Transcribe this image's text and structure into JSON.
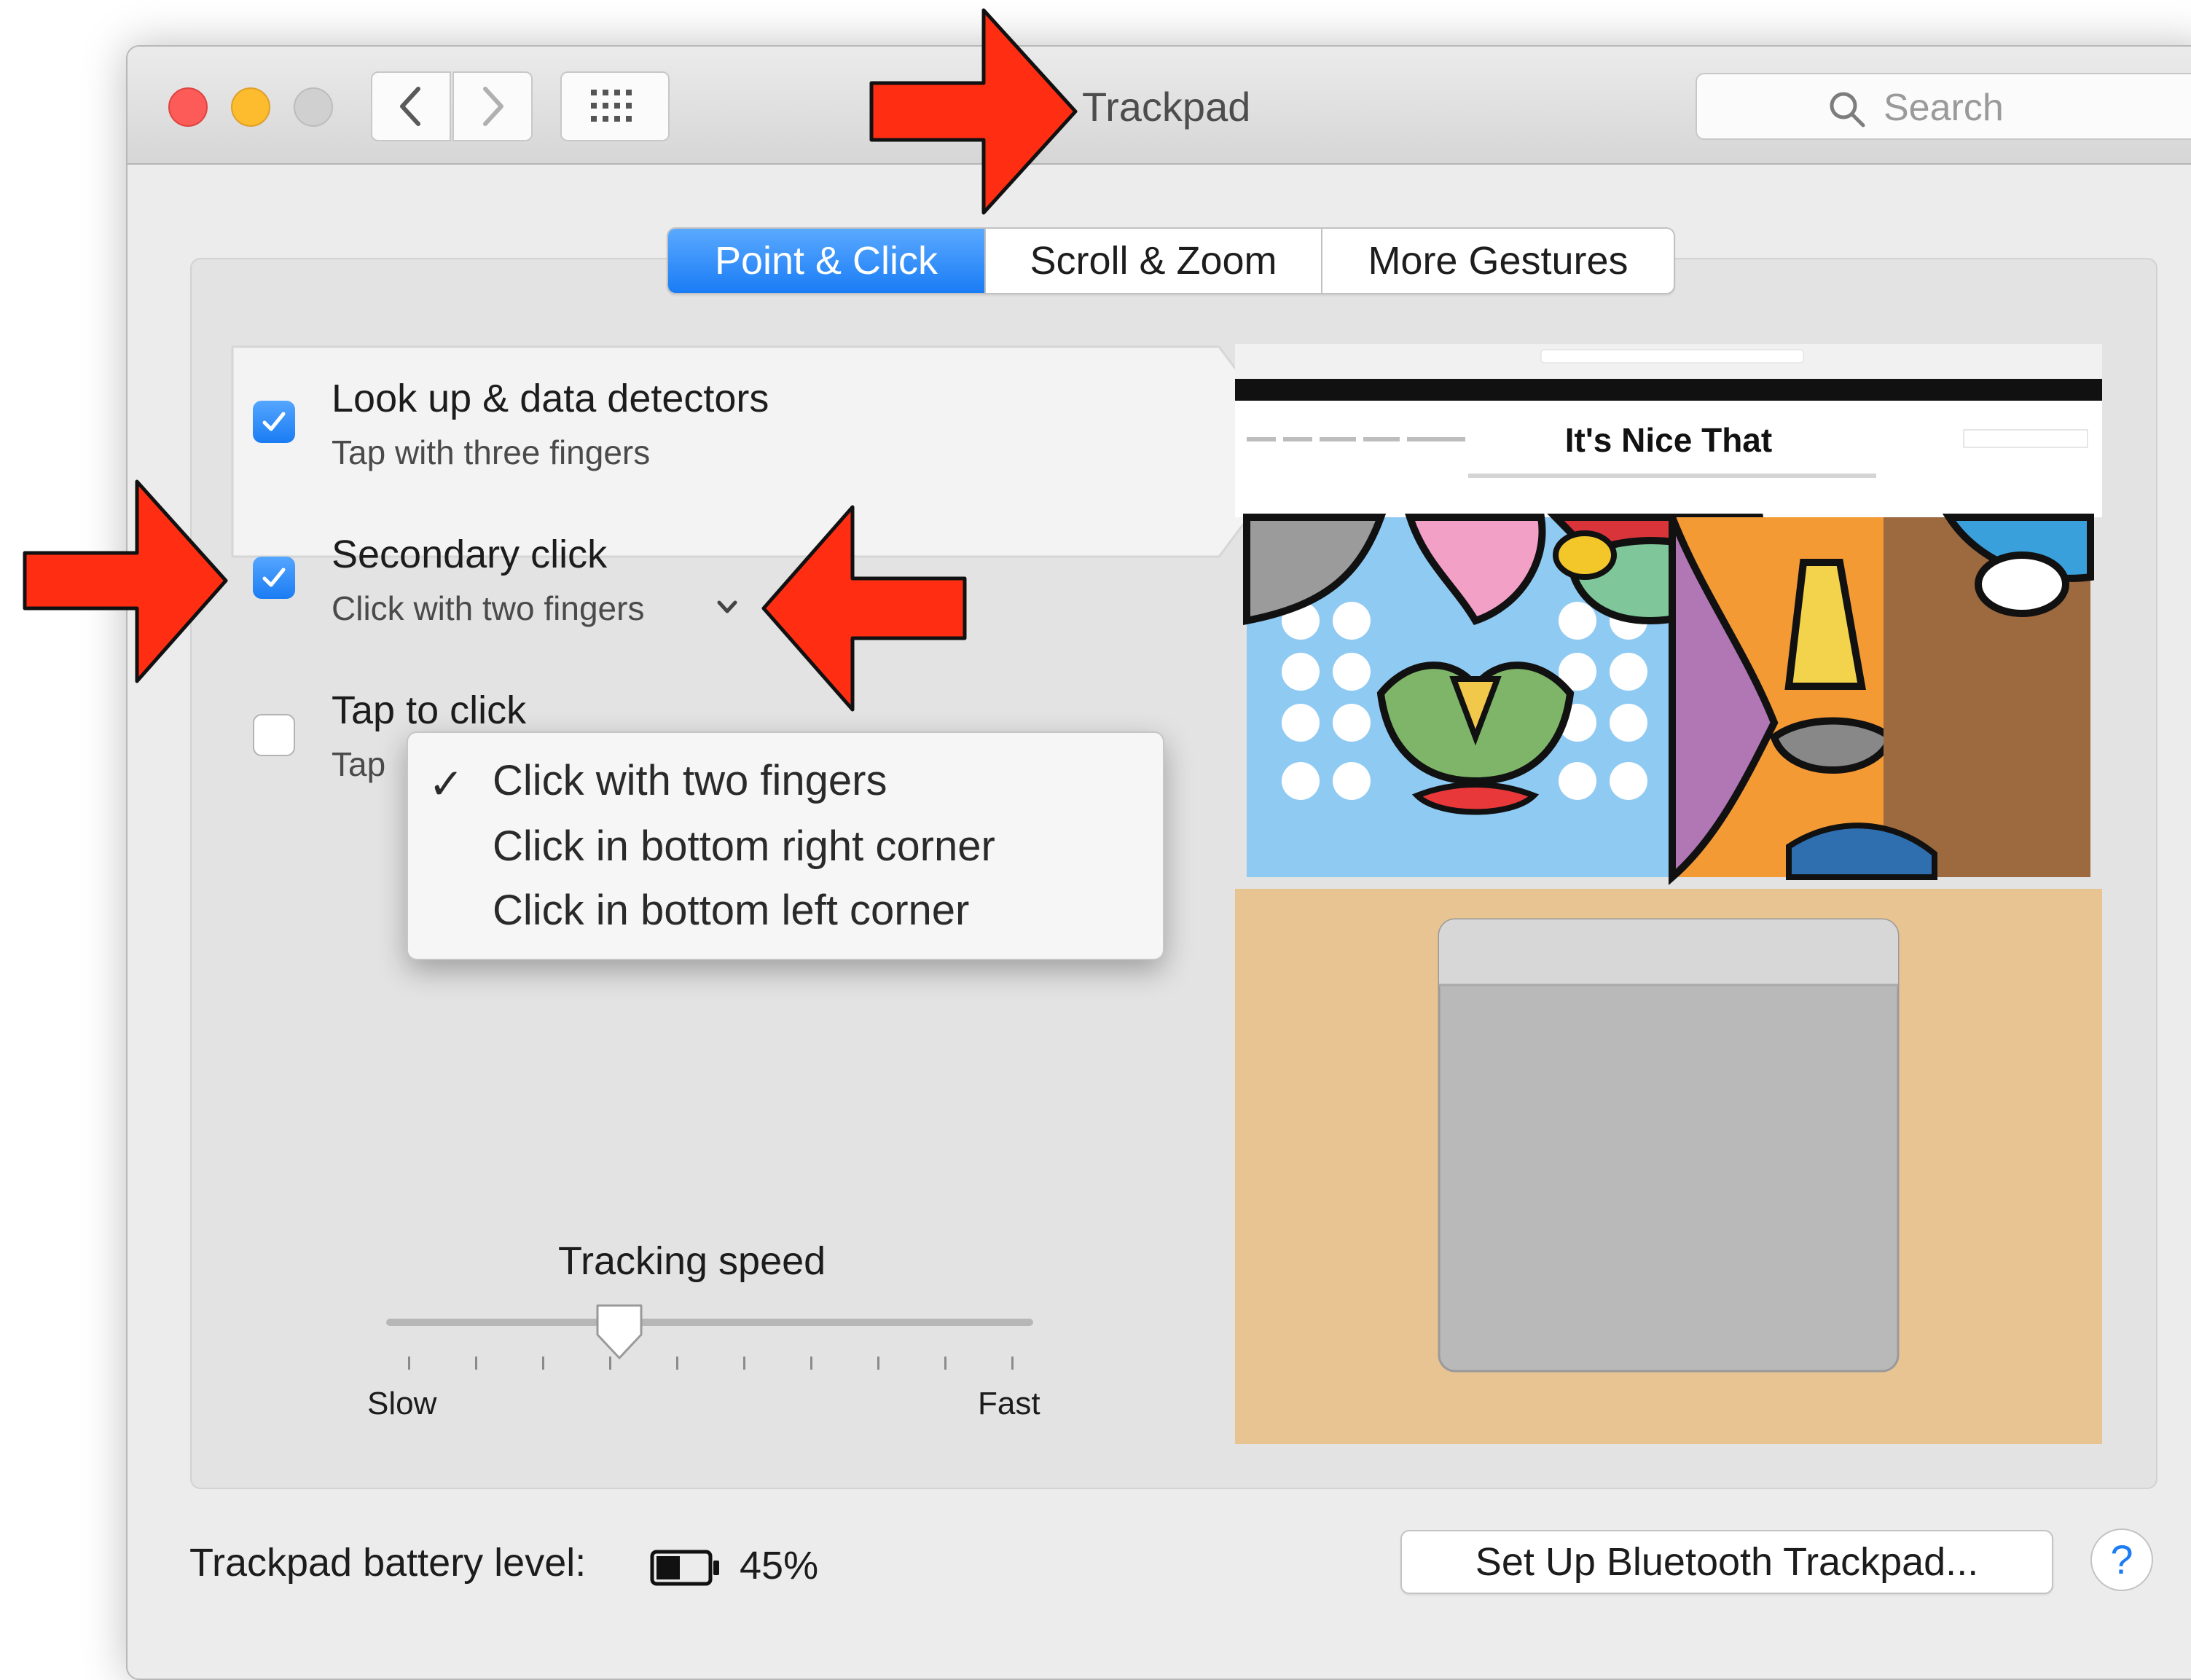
{
  "window": {
    "title": "Trackpad",
    "search_placeholder": "Search"
  },
  "tabs": [
    {
      "label": "Point & Click",
      "selected": true
    },
    {
      "label": "Scroll & Zoom",
      "selected": false
    },
    {
      "label": "More Gestures",
      "selected": false
    }
  ],
  "options": [
    {
      "title": "Look up & data detectors",
      "subtitle": "Tap with three fingers",
      "checked": true
    },
    {
      "title": "Secondary click",
      "subtitle": "Click with two fingers",
      "checked": true
    },
    {
      "title": "Tap to click",
      "subtitle": "Tap",
      "checked": false
    }
  ],
  "secondary_click_menu": {
    "items": [
      "Click with two fingers",
      "Click in bottom right corner",
      "Click in bottom left corner"
    ],
    "selected": "Click with two fingers",
    "check_glyph": "✓"
  },
  "tracking": {
    "label": "Tracking speed",
    "min_label": "Slow",
    "max_label": "Fast",
    "value_fraction": 0.35
  },
  "preview": {
    "site_title": "It's Nice That"
  },
  "footer": {
    "battery_label": "Trackpad battery level:",
    "battery_percent": "45%",
    "battery_level": 0.45,
    "setup_button": "Set Up Bluetooth Trackpad...",
    "help_glyph": "?"
  },
  "colors": {
    "accent": "#1b7cf3",
    "annotation_arrow": "#ff2e12"
  }
}
